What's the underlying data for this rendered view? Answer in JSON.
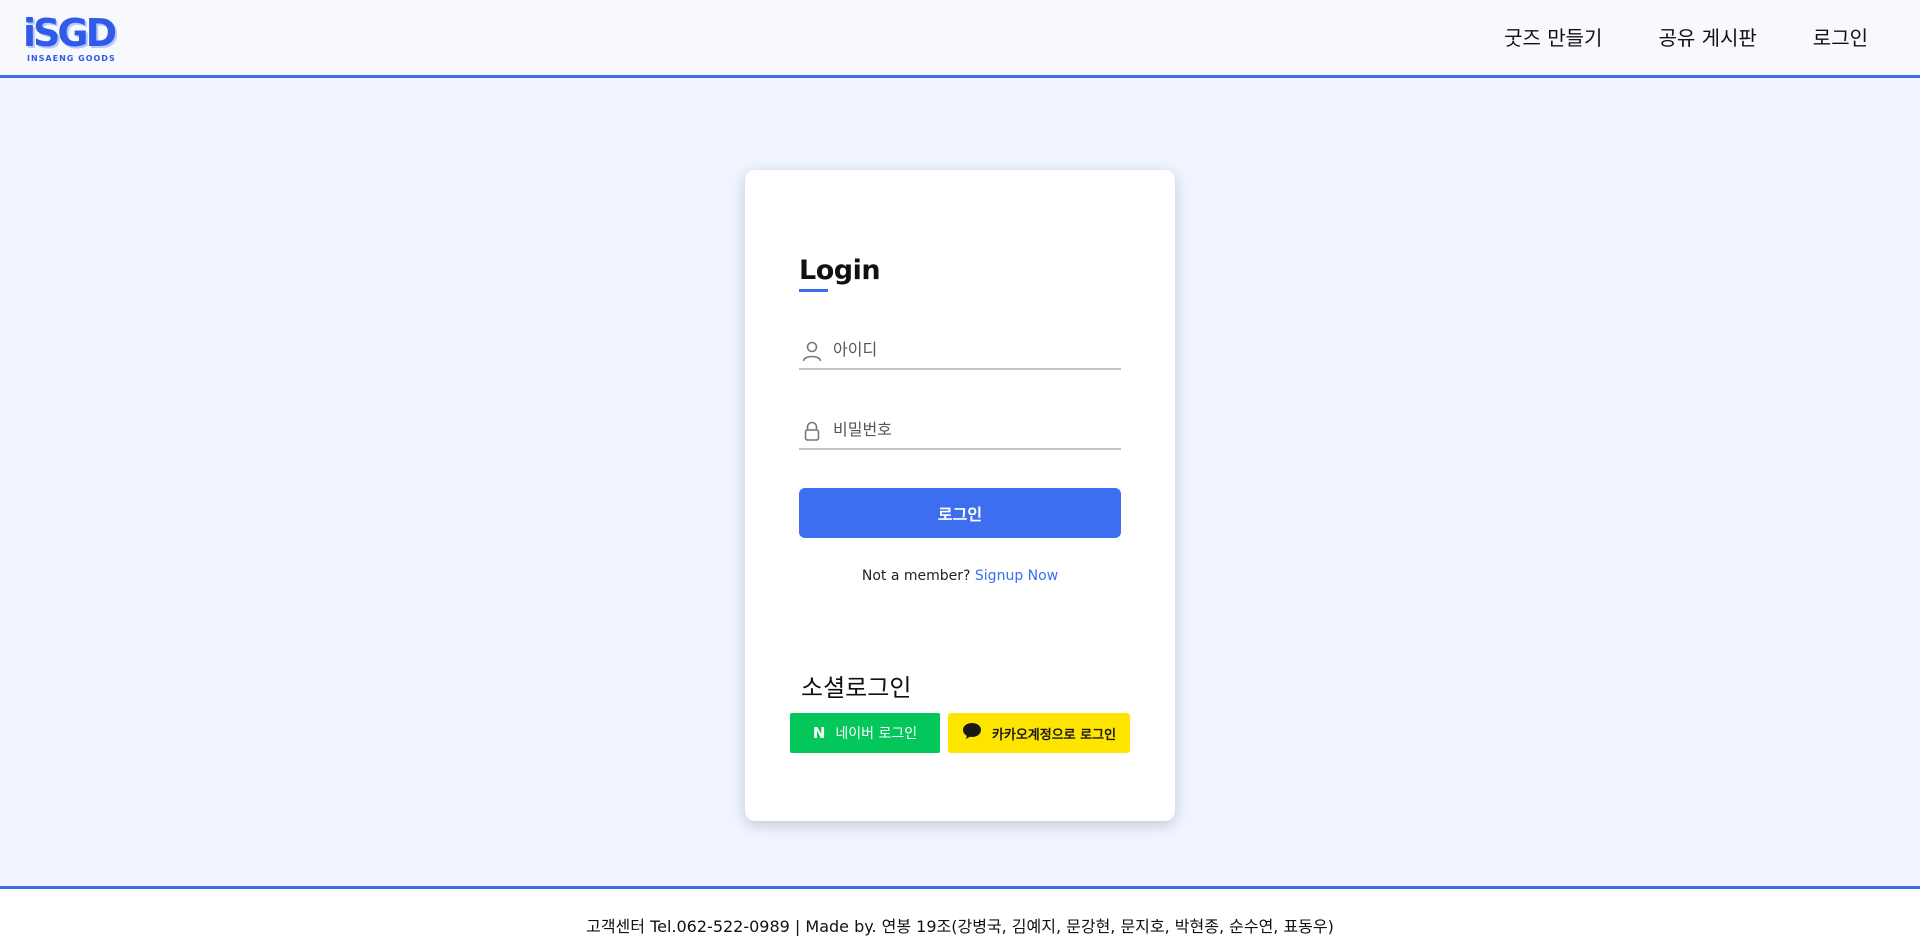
{
  "header": {
    "logo_text": "iSGD",
    "logo_subtext": "INSAENG GOODS",
    "nav": [
      {
        "label": "굿즈 만들기"
      },
      {
        "label": "공유 게시판"
      },
      {
        "label": "로그인"
      }
    ]
  },
  "login": {
    "title": "Login",
    "id_placeholder": "아이디",
    "pw_placeholder": "비밀번호",
    "id_icon": "user-icon",
    "pw_icon": "lock-icon",
    "submit_label": "로그인",
    "not_member_text": "Not a member?",
    "signup_link": "Signup Now"
  },
  "social": {
    "title": "소셜로그인",
    "naver_label": "네이버 로그인",
    "kakao_label": "카카오계정으로 로그인"
  },
  "footer": {
    "text": "고객센터 Tel.062-522-0989 | Made by. 연봉 19조(강병국, 김예지, 문강현, 문지호, 박현종, 순수연, 표동우)"
  },
  "colors": {
    "accent": "#3d6ef0",
    "page_bg": "#f0f4ff",
    "naver": "#03c75a",
    "kakao": "#fee500"
  }
}
